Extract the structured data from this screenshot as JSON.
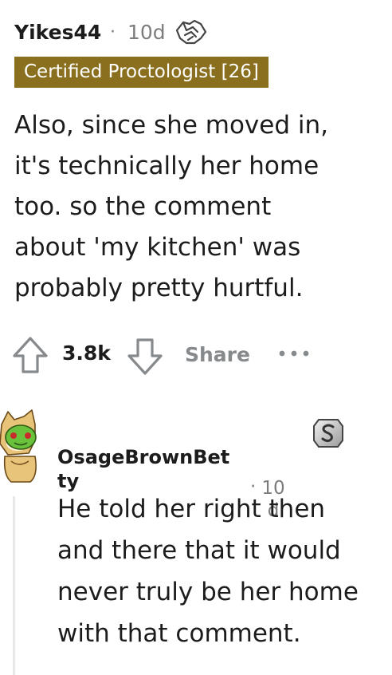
{
  "comment1": {
    "username": "Yikes44",
    "separator": "·",
    "age": "10d",
    "award_icon": "handshake-award-icon",
    "flair": "Certified Proctologist [26]",
    "body_lines": [
      "Also, since she moved in,",
      "it's technically her home",
      "too. so the comment",
      "about 'my kitchen' was",
      "probably pretty hurtful."
    ],
    "score": "3.8k",
    "share_label": "Share",
    "colors": {
      "flair_bg": "#8a6f1f",
      "meta_text": "#7c7c7c",
      "action_text": "#878a8c"
    }
  },
  "comment2": {
    "username_lines": [
      "OsageBrownBet",
      "ty"
    ],
    "separator": "·",
    "age_lines": [
      "10",
      "d"
    ],
    "avatar_icon": "snoo-doge-avatar-icon",
    "badge_icon": "silver-award-icon",
    "body_lines": [
      "He told her right then",
      "and there that it would",
      "never truly be her home",
      "with that comment."
    ]
  }
}
